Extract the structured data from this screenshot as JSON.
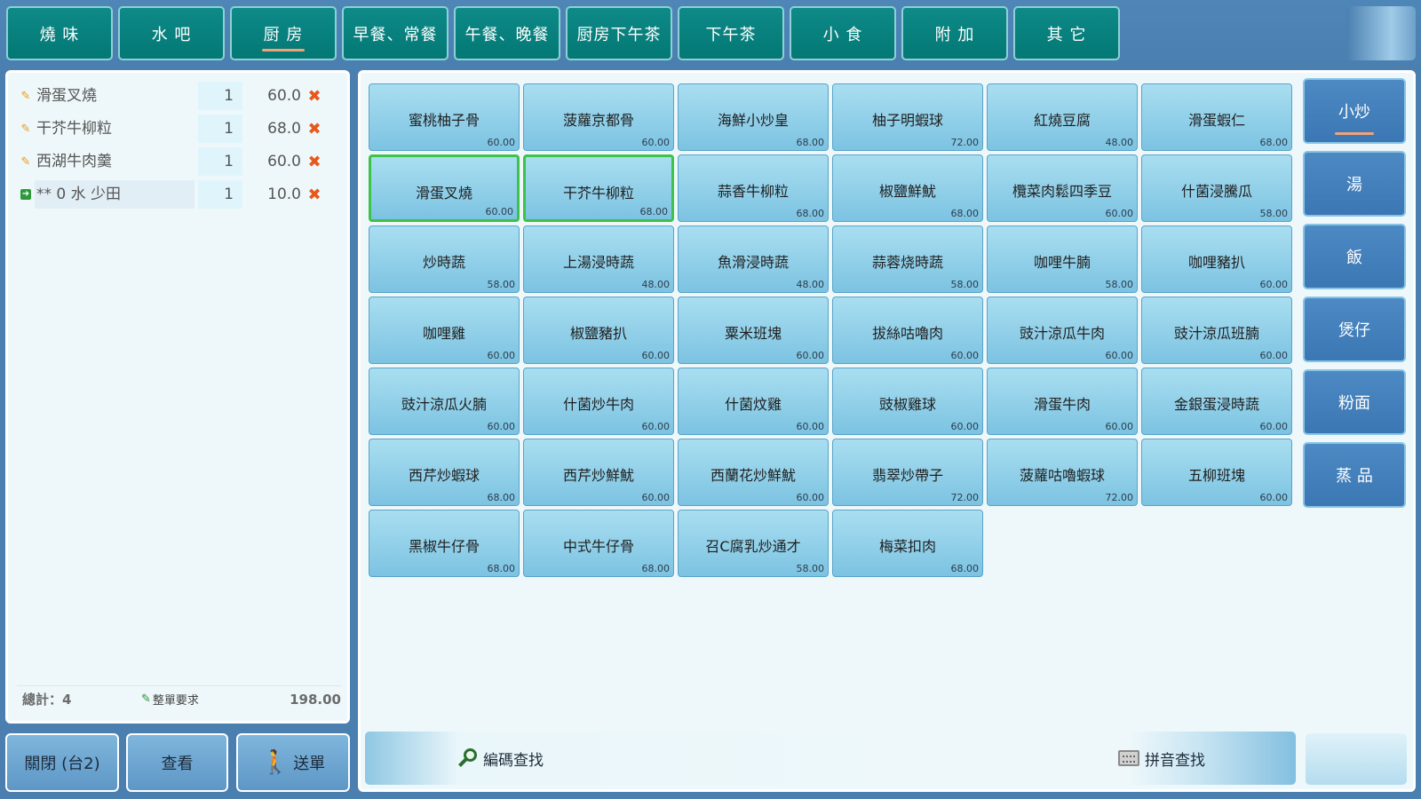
{
  "top_tabs": [
    {
      "label": "燒 味",
      "active": false
    },
    {
      "label": "水 吧",
      "active": false
    },
    {
      "label": "厨 房",
      "active": true
    },
    {
      "label": "早餐、常餐",
      "active": false
    },
    {
      "label": "午餐、晚餐",
      "active": false
    },
    {
      "label": "厨房下午茶",
      "active": false
    },
    {
      "label": "下午茶",
      "active": false
    },
    {
      "label": "小 食",
      "active": false
    },
    {
      "label": "附 加",
      "active": false
    },
    {
      "label": "其 它",
      "active": false
    }
  ],
  "order": {
    "items": [
      {
        "name": "滑蛋叉燒",
        "qty": "1",
        "price": "60.0",
        "icon": "pencil-icon"
      },
      {
        "name": "干芥牛柳粒",
        "qty": "1",
        "price": "68.0",
        "icon": "pencil-icon"
      },
      {
        "name": "西湖牛肉羹",
        "qty": "1",
        "price": "60.0",
        "icon": "pencil-icon"
      },
      {
        "name": "** 0 水 少田",
        "qty": "1",
        "price": "10.0",
        "icon": "send-icon"
      }
    ],
    "total_label": "總計：4",
    "request_label": "整單要求",
    "total_amount": "198.00"
  },
  "actions": {
    "close_label": "關閉 (台2)",
    "view_label": "查看",
    "send_label": "送單"
  },
  "menu_items": [
    {
      "name": "蜜桃柚子骨",
      "price": "60.00"
    },
    {
      "name": "菠蘿京都骨",
      "price": "60.00"
    },
    {
      "name": "海鮮小炒皇",
      "price": "68.00"
    },
    {
      "name": "柚子明蝦球",
      "price": "72.00"
    },
    {
      "name": "紅燒豆腐",
      "price": "48.00"
    },
    {
      "name": "滑蛋蝦仁",
      "price": "68.00"
    },
    {
      "name": "滑蛋叉燒",
      "price": "60.00",
      "selected": true
    },
    {
      "name": "干芥牛柳粒",
      "price": "68.00",
      "selected": true
    },
    {
      "name": "蒜香牛柳粒",
      "price": "68.00"
    },
    {
      "name": "椒鹽鮮魷",
      "price": "68.00"
    },
    {
      "name": "欖菜肉鬆四季豆",
      "price": "60.00"
    },
    {
      "name": "什菌浸騰瓜",
      "price": "58.00"
    },
    {
      "name": "炒時蔬",
      "price": "58.00"
    },
    {
      "name": "上湯浸時蔬",
      "price": "48.00"
    },
    {
      "name": "魚滑浸時蔬",
      "price": "48.00"
    },
    {
      "name": "蒜蓉烧時蔬",
      "price": "58.00"
    },
    {
      "name": "咖哩牛腩",
      "price": "58.00"
    },
    {
      "name": "咖哩豬扒",
      "price": "60.00"
    },
    {
      "name": "咖哩雞",
      "price": "60.00"
    },
    {
      "name": "椒鹽豬扒",
      "price": "60.00"
    },
    {
      "name": "粟米班塊",
      "price": "60.00"
    },
    {
      "name": "拔絲咕嚕肉",
      "price": "60.00"
    },
    {
      "name": "豉汁涼瓜牛肉",
      "price": "60.00"
    },
    {
      "name": "豉汁涼瓜班腩",
      "price": "60.00"
    },
    {
      "name": "豉汁涼瓜火腩",
      "price": "60.00"
    },
    {
      "name": "什菌炒牛肉",
      "price": "60.00"
    },
    {
      "name": "什菌炆雞",
      "price": "60.00"
    },
    {
      "name": "豉椒雞球",
      "price": "60.00"
    },
    {
      "name": "滑蛋牛肉",
      "price": "60.00"
    },
    {
      "name": "金銀蛋浸時蔬",
      "price": "60.00"
    },
    {
      "name": "西芹炒蝦球",
      "price": "68.00"
    },
    {
      "name": "西芹炒鮮魷",
      "price": "60.00"
    },
    {
      "name": "西蘭花炒鮮魷",
      "price": "60.00"
    },
    {
      "name": "翡翠炒帶子",
      "price": "72.00"
    },
    {
      "name": "菠蘿咕嚕蝦球",
      "price": "72.00"
    },
    {
      "name": "五柳班塊",
      "price": "60.00"
    },
    {
      "name": "黑椒牛仔骨",
      "price": "68.00"
    },
    {
      "name": "中式牛仔骨",
      "price": "68.00"
    },
    {
      "name": "召C腐乳炒通才",
      "price": "58.00"
    },
    {
      "name": "梅菜扣肉",
      "price": "68.00"
    }
  ],
  "sub_categories": [
    {
      "label": "小炒",
      "active": true
    },
    {
      "label": "湯",
      "active": false
    },
    {
      "label": "飯",
      "active": false
    },
    {
      "label": "煲仔",
      "active": false
    },
    {
      "label": "粉面",
      "active": false
    },
    {
      "label": "蒸 品",
      "active": false
    }
  ],
  "search": {
    "code_label": "編碼查找",
    "pinyin_label": "拼音查找"
  },
  "colors": {
    "tab_bg": "#037874",
    "menu_item_bg": "#7cc3e2",
    "selected_border": "#3dc24a",
    "subcategory_bg": "#3b77b3",
    "delete_icon": "#e8581c"
  }
}
